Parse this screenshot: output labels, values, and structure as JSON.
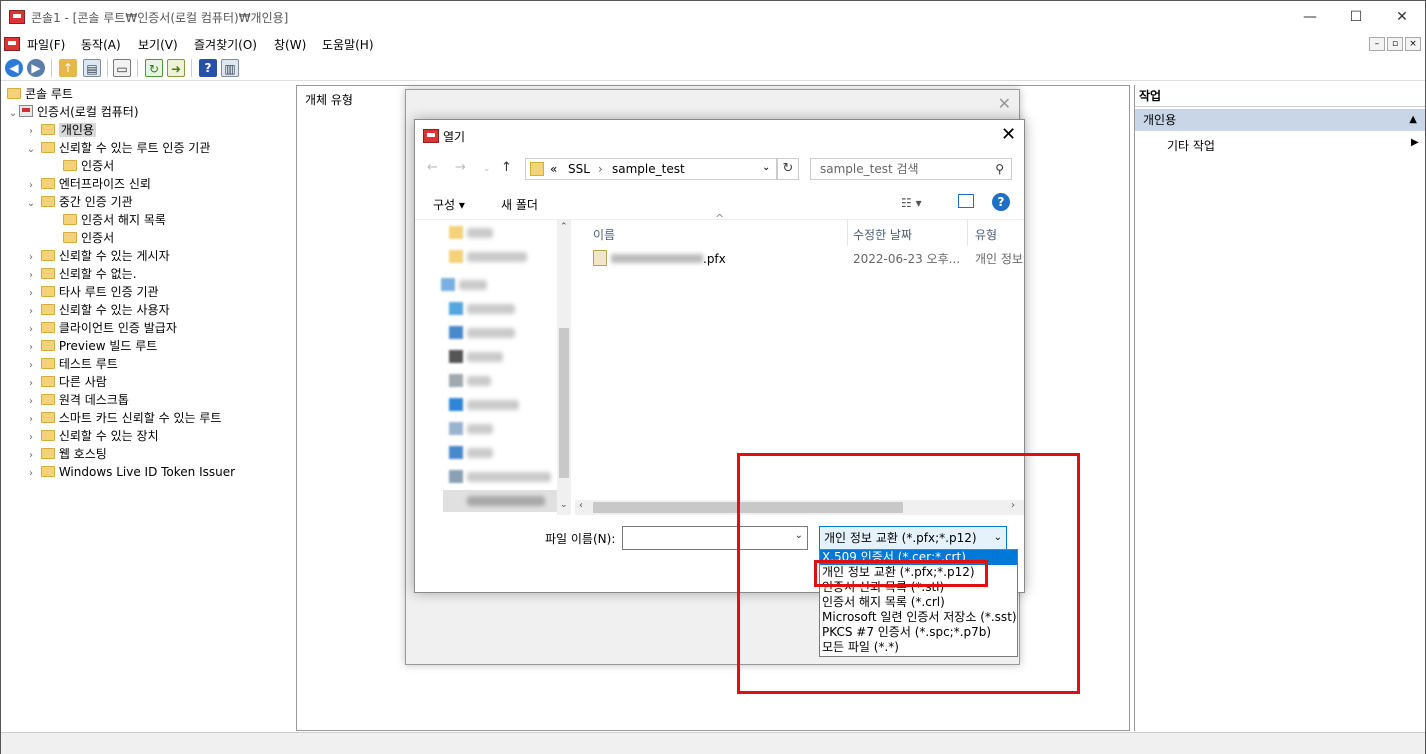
{
  "window": {
    "title": "콘솔1 - [콘솔 루트₩인증서(로컬 컴퓨터)₩개인용]",
    "minimize": "—",
    "maximize": "☐",
    "close": "✕"
  },
  "menu": [
    "파일(F)",
    "동작(A)",
    "보기(V)",
    "즐겨찾기(O)",
    "창(W)",
    "도움말(H)"
  ],
  "tree": {
    "root": "콘솔 루트",
    "store": "인증서(로컬 컴퓨터)",
    "items": [
      "개인용",
      "신뢰할 수 있는 루트 인증 기관",
      "인증서",
      "엔터프라이즈 신뢰",
      "중간 인증 기관",
      "인증서 해지 목록",
      "인증서",
      "신뢰할 수 있는 게시자",
      "신뢰할 수 없는.",
      "타사 루트 인증 기관",
      "신뢰할 수 있는 사용자",
      "클라이언트 인증 발급자",
      "Preview 빌드 루트",
      "테스트 루트",
      "다른 사람",
      "원격 데스크톱",
      "스마트 카드 신뢰할 수 있는 루트",
      "신뢰할 수 있는 장치",
      "웹 호스팅",
      "Windows Live ID Token Issuer"
    ]
  },
  "center": {
    "header": "개체 유형"
  },
  "actions": {
    "header": "작업",
    "selected": "개인용",
    "other": "기타 작업"
  },
  "open_dialog": {
    "title": "열기",
    "path": [
      "«",
      "SSL",
      "›",
      "sample_test"
    ],
    "search_placeholder": "sample_test 검색",
    "organize": "구성 ▾",
    "new_folder": "새 폴더",
    "columns": [
      "이름",
      "수정한 날짜",
      "유형"
    ],
    "file": {
      "name_suffix": ".pfx",
      "date": "2022-06-23 오후...",
      "type": "개인 정보"
    },
    "filename_label": "파일 이름(N):",
    "filetype_selected": "개인 정보 교환 (*.pfx;*.p12)",
    "filetype_options": [
      "X.509 인증서 (*.cer;*.crt)",
      "개인 정보 교환 (*.pfx;*.p12)",
      "인증서 신뢰 목록 (*.stl)",
      "인증서 해지 목록 (*.crl)",
      "Microsoft 일련 인증서 저장소 (*.sst)",
      "PKCS #7 인증서 (*.spc;*.p7b)",
      "모든 파일 (*.*)"
    ]
  },
  "colors": {
    "highlight_red": "#e01010",
    "select_blue": "#0078d7",
    "action_select": "#c8d6e8"
  }
}
